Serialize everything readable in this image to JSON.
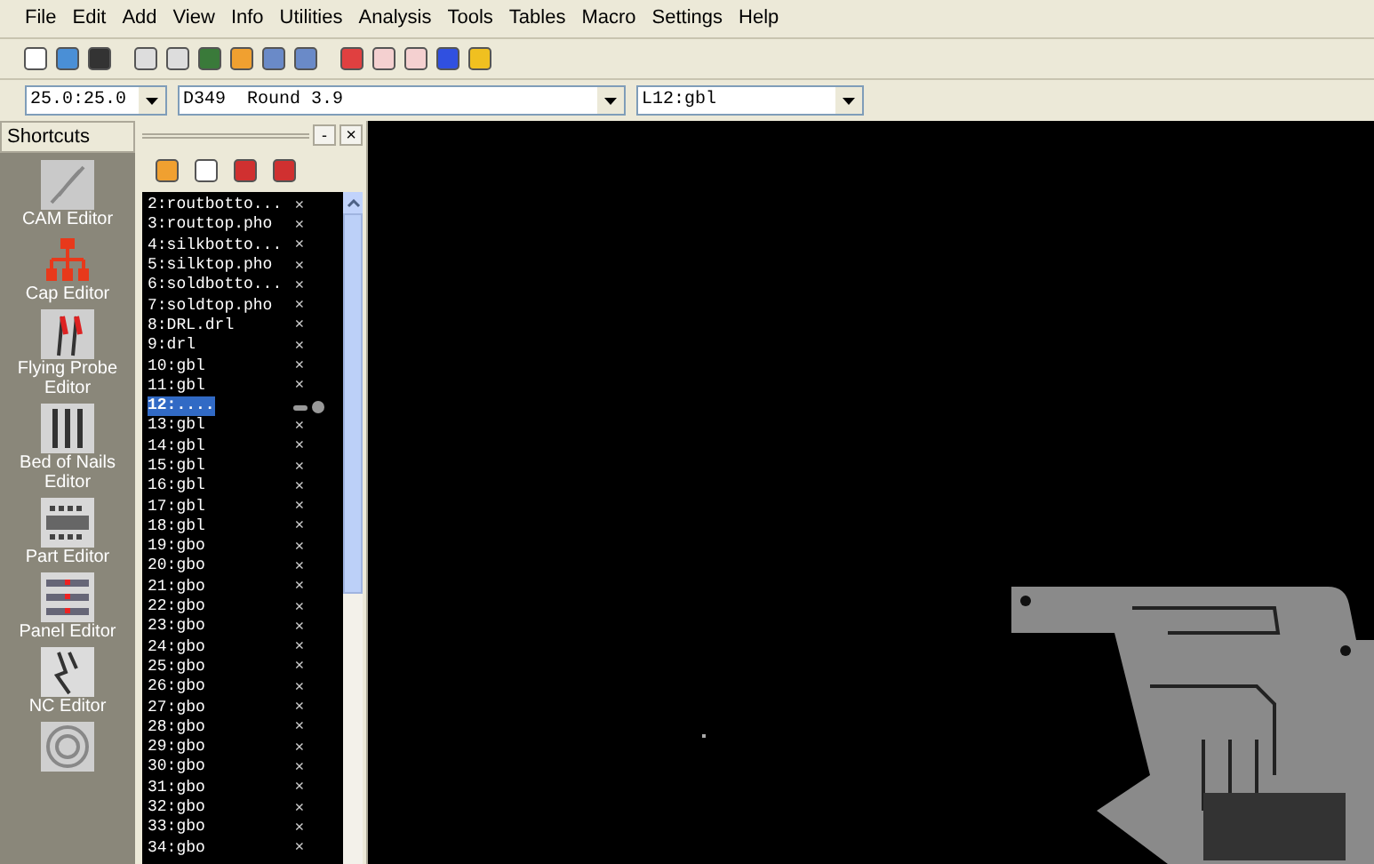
{
  "menu": [
    "File",
    "Edit",
    "Add",
    "View",
    "Info",
    "Utilities",
    "Analysis",
    "Tools",
    "Tables",
    "Macro",
    "Settings",
    "Help"
  ],
  "combos": [
    {
      "value": "25.0:25.0"
    },
    {
      "value": "D349  Round 3.9"
    },
    {
      "value": "L12:gbl"
    }
  ],
  "shortcuts": {
    "title": "Shortcuts",
    "items": [
      {
        "label": "CAM Editor",
        "kind": "cam"
      },
      {
        "label": "Cap Editor",
        "kind": "cap"
      },
      {
        "label": "Flying Probe Editor",
        "kind": "probe"
      },
      {
        "label": "Bed of Nails Editor",
        "kind": "nails"
      },
      {
        "label": "Part Editor",
        "kind": "part"
      },
      {
        "label": "Panel Editor",
        "kind": "panel"
      },
      {
        "label": "NC Editor",
        "kind": "nc"
      },
      {
        "kind": "target"
      }
    ]
  },
  "layers": {
    "min_button": "-",
    "close_button": "×",
    "rows": [
      {
        "label": "2:routbotto...",
        "selected": false,
        "mark": "×"
      },
      {
        "label": "3:routtop.pho",
        "selected": false,
        "mark": "×"
      },
      {
        "label": "4:silkbotto...",
        "selected": false,
        "mark": "×"
      },
      {
        "label": "5:silktop.pho",
        "selected": false,
        "mark": "×"
      },
      {
        "label": "6:soldbotto...",
        "selected": false,
        "mark": "×"
      },
      {
        "label": "7:soldtop.pho",
        "selected": false,
        "mark": "×"
      },
      {
        "label": "8:DRL.drl",
        "selected": false,
        "mark": "×"
      },
      {
        "label": "9:drl",
        "selected": false,
        "mark": "×"
      },
      {
        "label": "10:gbl",
        "selected": false,
        "mark": "×"
      },
      {
        "label": "11:gbl",
        "selected": false,
        "mark": "×"
      },
      {
        "label": "12:....",
        "selected": true
      },
      {
        "label": "13:gbl",
        "selected": false,
        "mark": "×"
      },
      {
        "label": "14:gbl",
        "selected": false,
        "mark": "×"
      },
      {
        "label": "15:gbl",
        "selected": false,
        "mark": "×"
      },
      {
        "label": "16:gbl",
        "selected": false,
        "mark": "×"
      },
      {
        "label": "17:gbl",
        "selected": false,
        "mark": "×"
      },
      {
        "label": "18:gbl",
        "selected": false,
        "mark": "×"
      },
      {
        "label": "19:gbo",
        "selected": false,
        "mark": "×"
      },
      {
        "label": "20:gbo",
        "selected": false,
        "mark": "×"
      },
      {
        "label": "21:gbo",
        "selected": false,
        "mark": "×"
      },
      {
        "label": "22:gbo",
        "selected": false,
        "mark": "×"
      },
      {
        "label": "23:gbo",
        "selected": false,
        "mark": "×"
      },
      {
        "label": "24:gbo",
        "selected": false,
        "mark": "×"
      },
      {
        "label": "25:gbo",
        "selected": false,
        "mark": "×"
      },
      {
        "label": "26:gbo",
        "selected": false,
        "mark": "×"
      },
      {
        "label": "27:gbo",
        "selected": false,
        "mark": "×"
      },
      {
        "label": "28:gbo",
        "selected": false,
        "mark": "×"
      },
      {
        "label": "29:gbo",
        "selected": false,
        "mark": "×"
      },
      {
        "label": "30:gbo",
        "selected": false,
        "mark": "×"
      },
      {
        "label": "31:gbo",
        "selected": false,
        "mark": "×"
      },
      {
        "label": "32:gbo",
        "selected": false,
        "mark": "×"
      },
      {
        "label": "33:gbo",
        "selected": false,
        "mark": "×"
      },
      {
        "label": "34:gbo",
        "selected": false,
        "mark": "×"
      }
    ]
  }
}
